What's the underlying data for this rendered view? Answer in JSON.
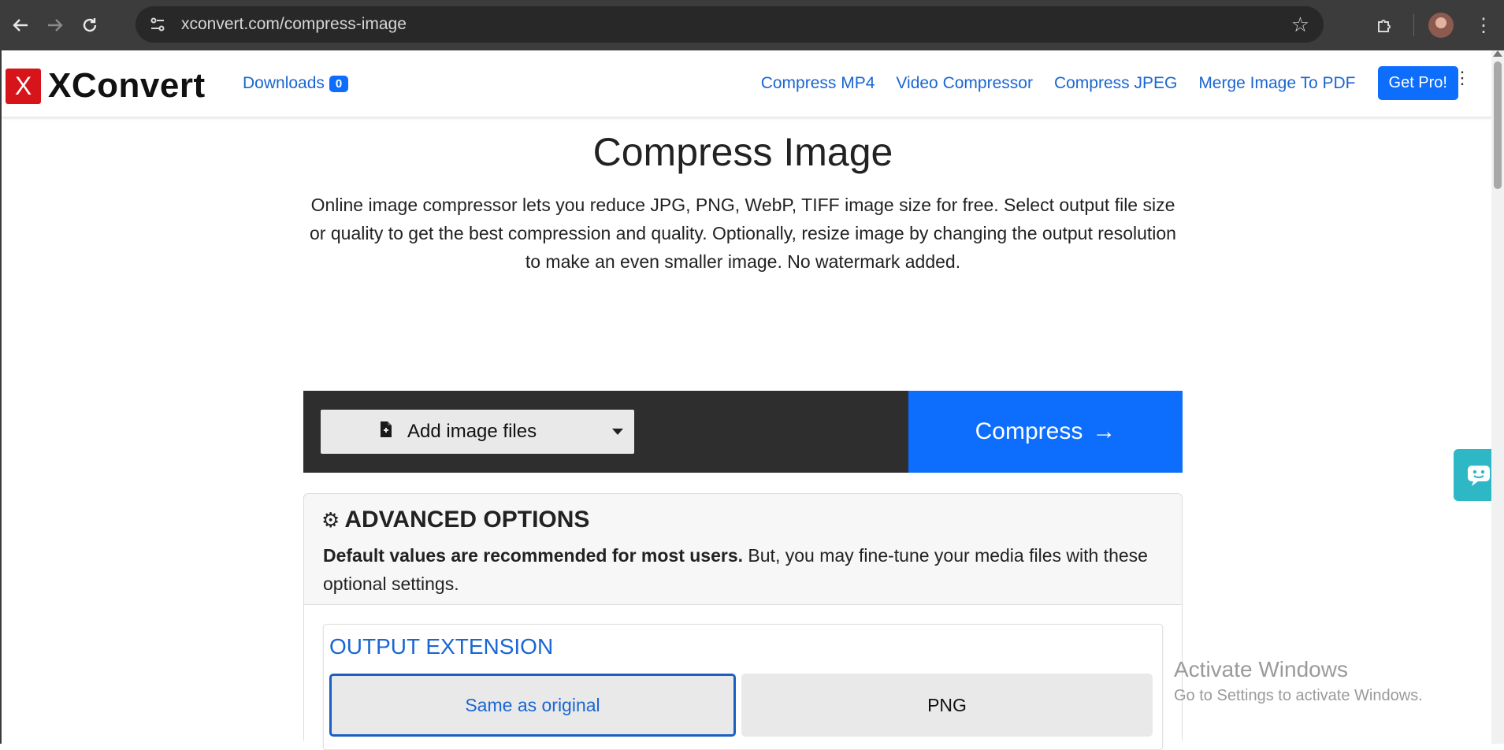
{
  "browser": {
    "url": "xconvert.com/compress-image"
  },
  "icons": {
    "back": "arrow-left-icon",
    "forward": "arrow-right-icon",
    "reload": "reload-icon",
    "site_info": "site-settings-icon",
    "star": "bookmark-star-icon",
    "extensions": "puzzle-icon",
    "menu": "vertical-dots-icon",
    "add_file": "file-icon",
    "gear": "gear-icon",
    "chat": "chat-icon"
  },
  "header": {
    "logo_letter": "X",
    "logo_text": "XConvert",
    "downloads_label": "Downloads",
    "downloads_count": "0",
    "nav_links": [
      "Compress MP4",
      "Video Compressor",
      "Compress JPEG",
      "Merge Image To PDF"
    ],
    "get_pro": "Get Pro!"
  },
  "main": {
    "title": "Compress Image",
    "description": "Online image compressor lets you reduce JPG, PNG, WebP, TIFF image size for free. Select output file size or quality to get the best compression and quality. Optionally, resize image by changing the output resolution to make an even smaller image. No watermark added."
  },
  "toolbar": {
    "add_files_label": "Add image files",
    "compress_label": "Compress"
  },
  "advanced": {
    "title": "ADVANCED OPTIONS",
    "desc_bold": "Default values are recommended for most users.",
    "desc_rest": " But, you may fine-tune your media files with these optional settings.",
    "output_title": "OUTPUT EXTENSION",
    "options": [
      "Same as original",
      "PNG"
    ],
    "selected": "Same as original"
  },
  "overlay": {
    "activate_title": "Activate Windows",
    "activate_sub": "Go to Settings to activate Windows."
  },
  "colors": {
    "brand_red": "#d7141a",
    "primary_blue": "#0d6efd",
    "link_blue": "#1a66d2",
    "chat_teal": "#2eb8c6"
  }
}
